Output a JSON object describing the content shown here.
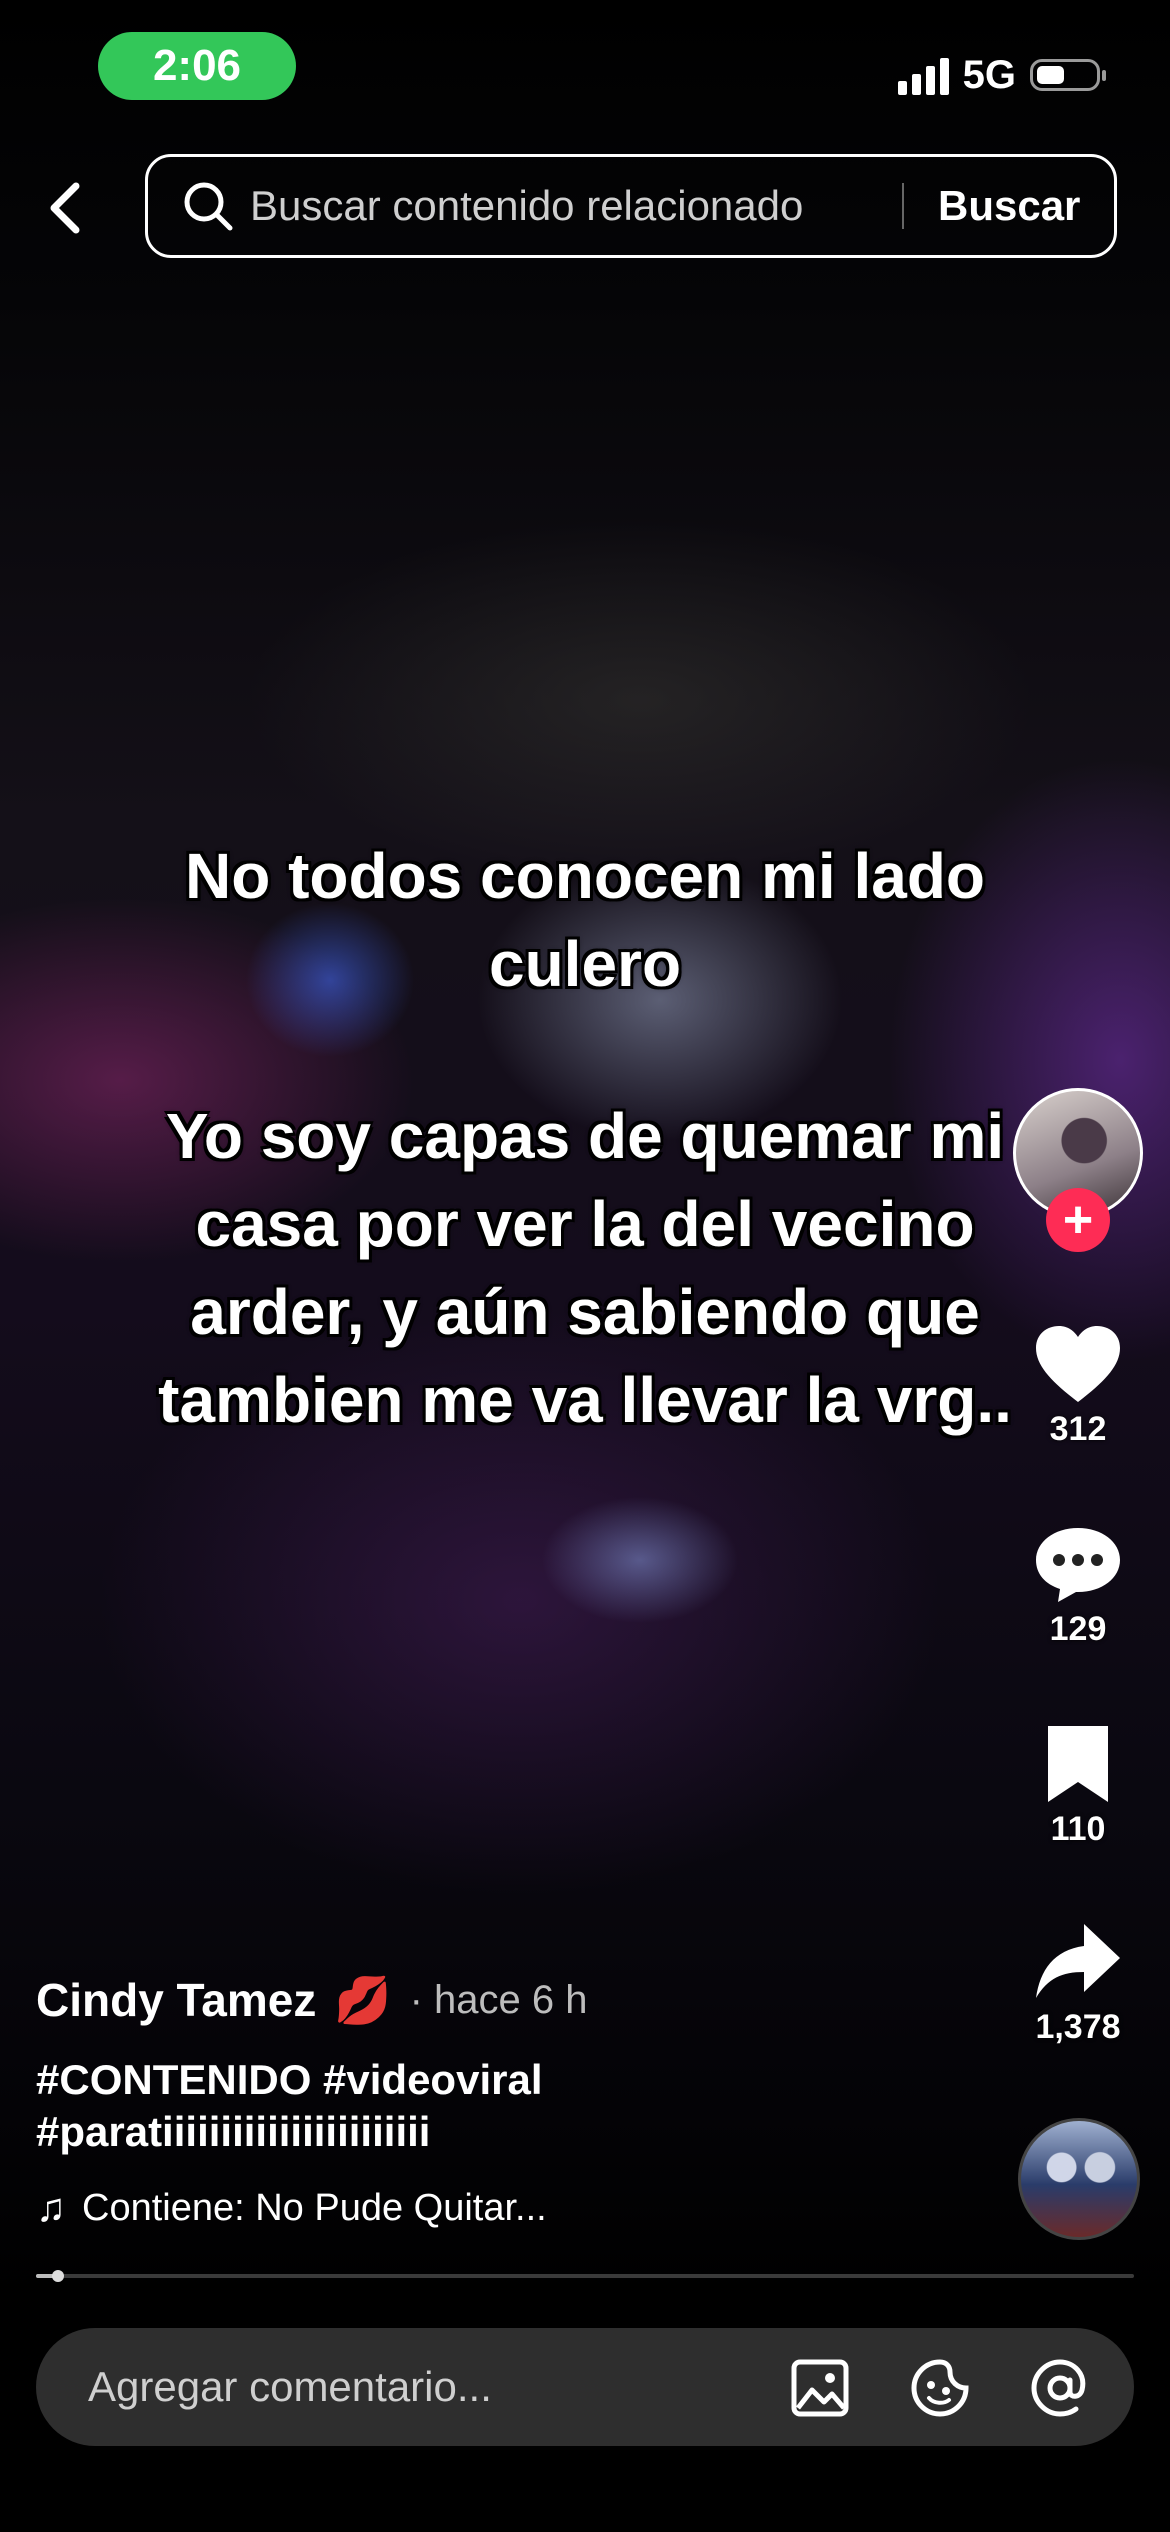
{
  "status_bar": {
    "time": "2:06",
    "network": "5G",
    "signal_bars": 4,
    "battery_level": 0.35
  },
  "search": {
    "placeholder": "Buscar contenido relacionado",
    "button_label": "Buscar"
  },
  "caption": {
    "line1": "No todos conocen mi lado culero",
    "line2": "Yo soy capas de quemar mi casa por ver la del vecino arder, y aún sabiendo que tambien me va llevar la vrg.."
  },
  "actions": {
    "likes": "312",
    "comments": "129",
    "saves": "110",
    "shares": "1,378"
  },
  "post": {
    "author": "Cindy Tamez",
    "author_emoji": "💋",
    "time_ago": "· hace 6 h",
    "hashtags": "#CONTENIDO #videoviral #paratiiiiiiiiiiiiiiiiiiiiiii",
    "music": "Contiene: No Pude Quitar...",
    "progress": 0.02
  },
  "comment_bar": {
    "placeholder": "Agregar comentario..."
  },
  "icons": [
    "back-icon",
    "search-icon",
    "heart-icon",
    "comment-icon",
    "bookmark-icon",
    "share-icon",
    "music-note-icon",
    "image-icon",
    "emoji-sticker-icon",
    "mention-icon"
  ],
  "colors": {
    "accent_green": "#33c759",
    "follow_red": "#fe2c55"
  }
}
